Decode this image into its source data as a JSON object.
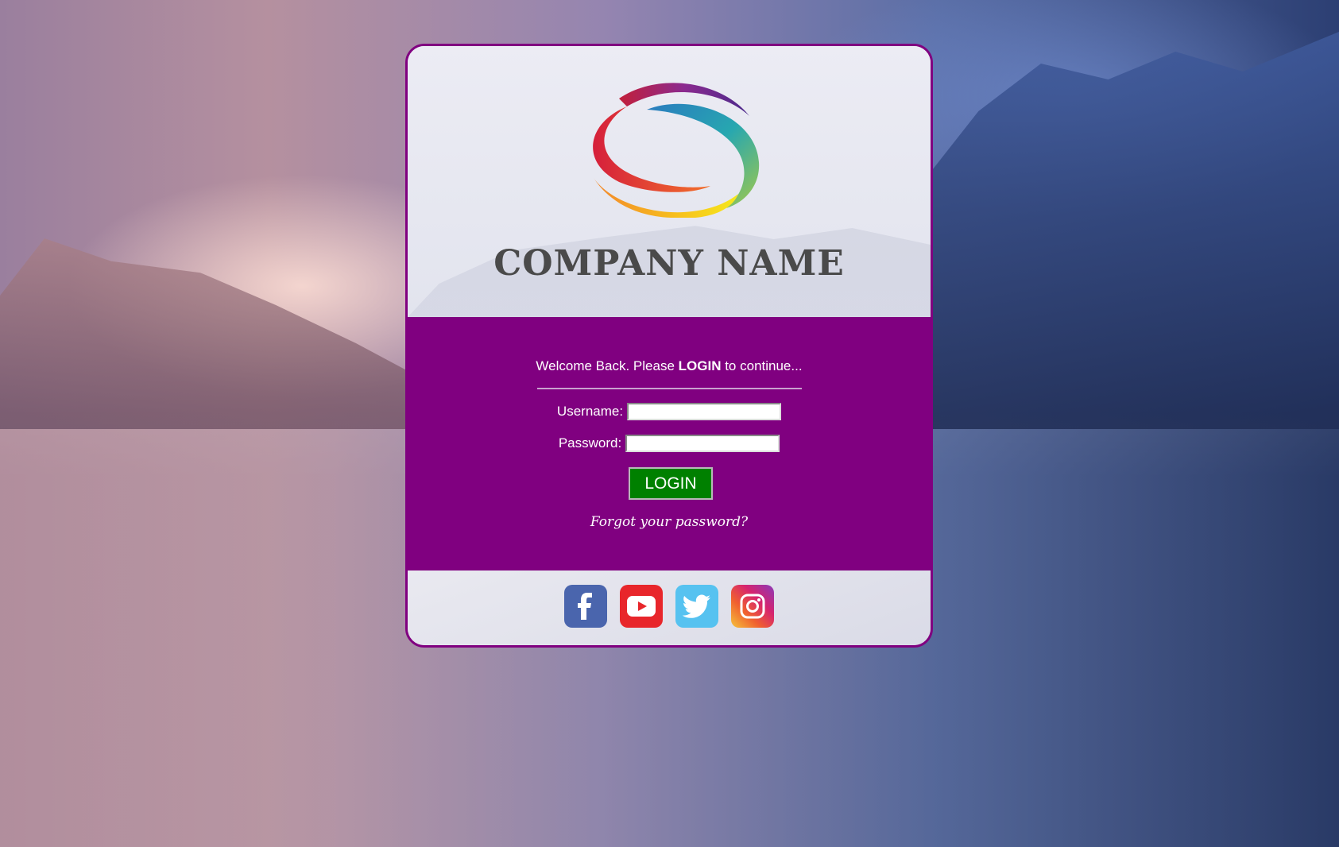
{
  "brand": {
    "company_name": "COMPANY NAME",
    "logo_icon": "swirl-logo"
  },
  "login_form": {
    "welcome_prefix": "Welcome Back. Please ",
    "welcome_emphasis": "LOGIN",
    "welcome_suffix": " to continue...",
    "username_label": "Username:",
    "username_value": "",
    "password_label": "Password:",
    "password_value": "",
    "login_button": "LOGIN",
    "forgot_link": "Forgot your password?"
  },
  "social_links": [
    {
      "name": "facebook-icon",
      "color": "#4a65ad"
    },
    {
      "name": "youtube-icon",
      "color": "#e8262b"
    },
    {
      "name": "twitter-icon",
      "color": "#56c2f0"
    },
    {
      "name": "instagram-icon",
      "color": "#d6246f"
    }
  ],
  "colors": {
    "card_border": "#800080",
    "form_background": "#800080",
    "login_button": "#008000"
  }
}
